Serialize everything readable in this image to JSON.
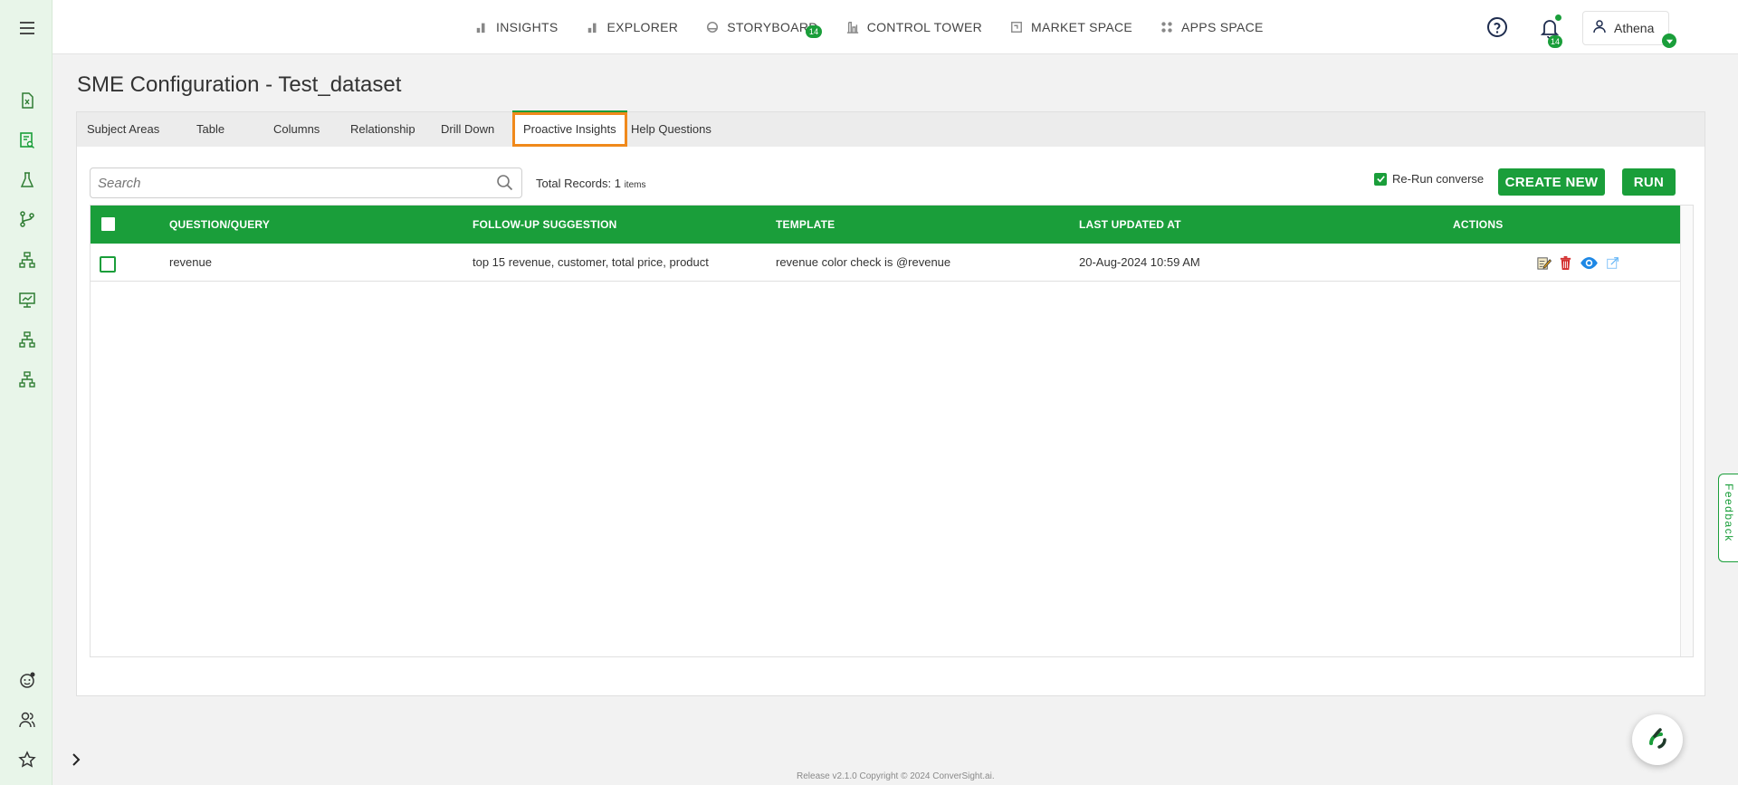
{
  "nav": {
    "items": [
      {
        "label": "INSIGHTS",
        "icon": "bar-chart-icon"
      },
      {
        "label": "EXPLORER",
        "icon": "bar-chart-icon"
      },
      {
        "label": "STORYBOARD",
        "icon": "storyboard-icon",
        "badge": "14"
      },
      {
        "label": "CONTROL TOWER",
        "icon": "tower-icon"
      },
      {
        "label": "MARKET SPACE",
        "icon": "market-icon"
      },
      {
        "label": "APPS SPACE",
        "icon": "apps-grid-icon"
      }
    ]
  },
  "header": {
    "notifications_count": "14",
    "user_name": "Athena"
  },
  "page": {
    "title": "SME Configuration - Test_dataset"
  },
  "tabs": [
    {
      "label": "Subject Areas"
    },
    {
      "label": "Table"
    },
    {
      "label": "Columns"
    },
    {
      "label": "Relationship"
    },
    {
      "label": "Drill Down"
    },
    {
      "label": "Proactive Insights",
      "active": true
    },
    {
      "label": "Help Questions"
    }
  ],
  "toolbar": {
    "search_placeholder": "Search",
    "total_label": "Total Records:",
    "total_count": "1",
    "total_unit": "items",
    "rerun_label": "Re-Run converse",
    "rerun_checked": true,
    "create_label": "CREATE NEW",
    "run_label": "RUN"
  },
  "table": {
    "columns": [
      "QUESTION/QUERY",
      "FOLLOW-UP SUGGESTION",
      "TEMPLATE",
      "LAST UPDATED AT",
      "ACTIONS"
    ],
    "rows": [
      {
        "question": "revenue",
        "followup": "top 15 revenue, customer, total price, product",
        "template": "revenue color check is @revenue",
        "updated": "20-Aug-2024 10:59 AM"
      }
    ]
  },
  "feedback_label": "Feedback",
  "footer": "Release v2.1.0 Copyright © 2024 ConverSight.ai.",
  "colors": {
    "accent": "#1a9e3a",
    "active_tab_outline": "#f0891b",
    "delete": "#d32f2f",
    "view": "#1e88e5"
  }
}
